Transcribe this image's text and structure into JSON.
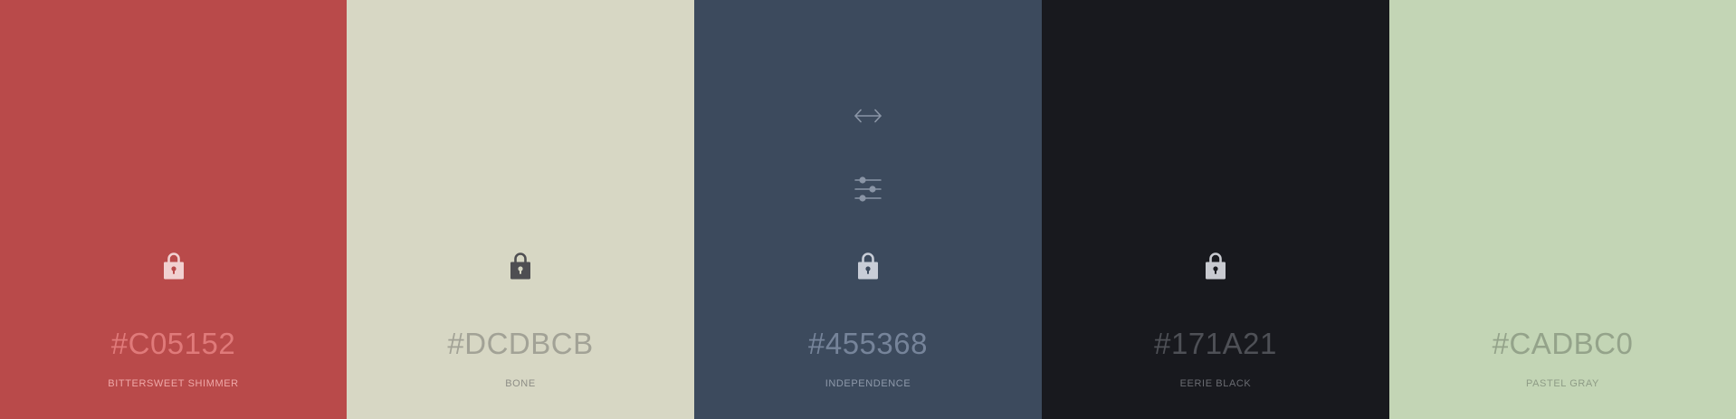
{
  "palette": {
    "colors": [
      {
        "hex": "#C05152",
        "name": "BITTERSWEET SHIMMER",
        "background": "#B94A4A",
        "text_color": "#E07A7A",
        "name_color": "#EFA8A8",
        "lock_color": "#F1D1D1",
        "lock_hole": "#B94A4A"
      },
      {
        "hex": "#DCDBCB",
        "name": "BONE",
        "background": "#D7D7C4",
        "text_color": "#A2A296",
        "name_color": "#8E8E86",
        "lock_color": "#4E4E52",
        "lock_hole": "#D7D7C4"
      },
      {
        "hex": "#455368",
        "name": "INDEPENDENCE",
        "background": "#3C4A5D",
        "text_color": "#76849A",
        "name_color": "#8E99AA",
        "lock_color": "#C8CDD7",
        "lock_hole": "#3C4A5D",
        "icon_color": "#8A95A6"
      },
      {
        "hex": "#171A21",
        "name": "EERIE BLACK",
        "background": "#18191E",
        "text_color": "#4E5056",
        "name_color": "#6A6C72",
        "lock_color": "#C8CAD0",
        "lock_hole": "#18191E"
      },
      {
        "hex": "#CADBC0",
        "name": "PASTEL GRAY",
        "background": "#C3D5B5",
        "text_color": "#94A38A",
        "name_color": "#8E9C86",
        "lock_color": "#C3D5B5",
        "lock_hole": "#C3D5B5"
      }
    ],
    "hovered_index": 2,
    "icons": {
      "expand": "expand-horizontal-icon",
      "adjust": "sliders-icon",
      "lock": "lock-icon"
    }
  }
}
